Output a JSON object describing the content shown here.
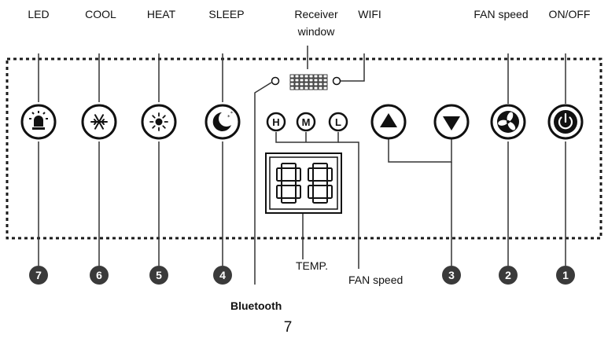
{
  "top_labels": {
    "led": "LED",
    "cool": "COOL",
    "heat": "HEAT",
    "sleep": "SLEEP",
    "receiver_line1": "Receiver",
    "receiver_line2": "window",
    "wifi": "WIFI",
    "fan_speed": "FAN speed",
    "on_off": "ON/OFF"
  },
  "fan_speed_indicators": [
    "H",
    "M",
    "L"
  ],
  "display_digits": "88",
  "callout_numbers": [
    "7",
    "6",
    "5",
    "4",
    "3",
    "2",
    "1"
  ],
  "bottom_labels": {
    "temp": "TEMP.",
    "fan_speed": "FAN speed",
    "bluetooth": "Bluetooth"
  },
  "page_number": "7",
  "icons": [
    "led-icon",
    "snowflake-icon",
    "sun-icon",
    "moon-icon",
    "up-arrow-icon",
    "down-arrow-icon",
    "fan-icon",
    "power-icon"
  ]
}
